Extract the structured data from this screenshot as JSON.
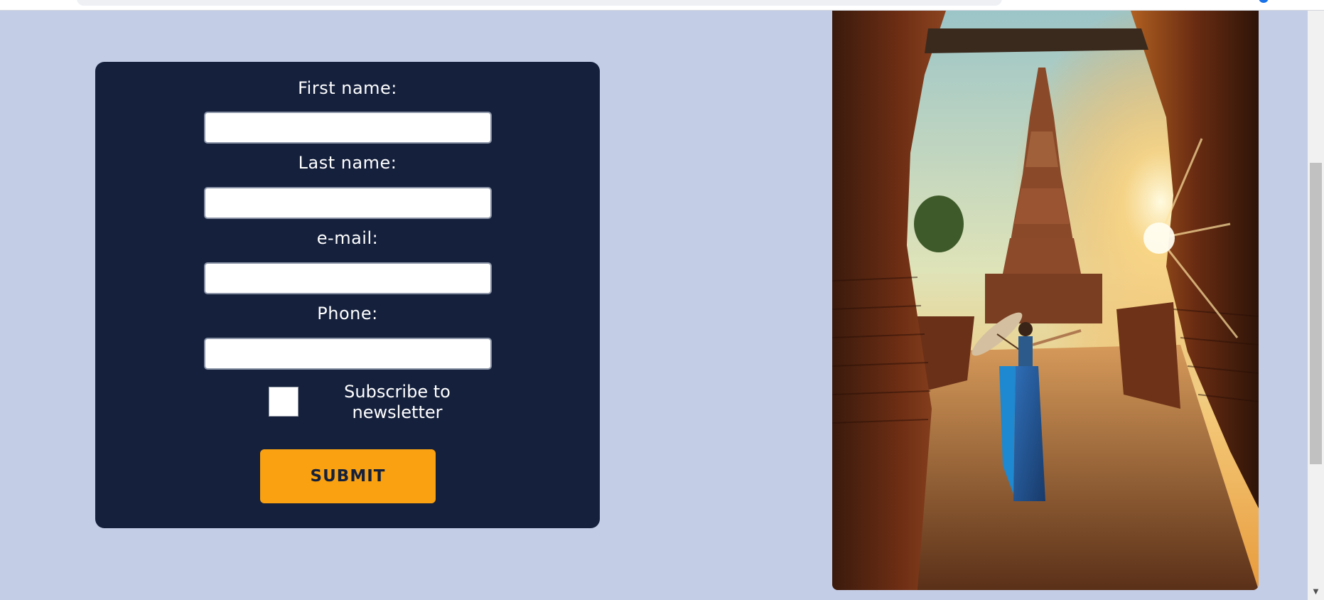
{
  "form": {
    "first_name_label": "First name:",
    "last_name_label": "Last name:",
    "email_label": "e-mail:",
    "phone_label": "Phone:",
    "first_name_value": "",
    "last_name_value": "",
    "email_value": "",
    "phone_value": "",
    "subscribe_label": "Subscribe to newsletter",
    "subscribe_checked": false,
    "submit_label": "SUBMIT"
  },
  "image": {
    "subject": "woman with parasol walking toward temple pagoda at sunset"
  },
  "colors": {
    "page_background": "#c4cde6",
    "form_background": "#14203c",
    "submit_background": "#f9a111",
    "submit_text": "#14203c"
  },
  "icons": {
    "scroll_down": "triangle-down-icon"
  }
}
